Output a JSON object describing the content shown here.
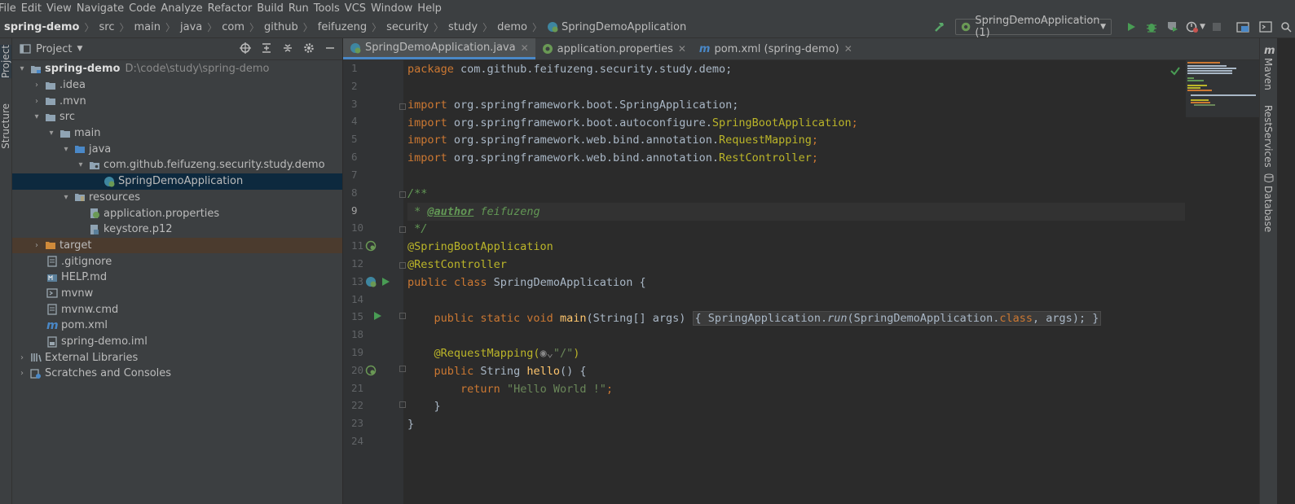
{
  "menu": [
    "File",
    "Edit",
    "View",
    "Navigate",
    "Code",
    "Analyze",
    "Refactor",
    "Build",
    "Run",
    "Tools",
    "VCS",
    "Window",
    "Help"
  ],
  "breadcrumb": {
    "project": "spring-demo",
    "items": [
      "src",
      "main",
      "java",
      "com",
      "github",
      "feifuzeng",
      "security",
      "study",
      "demo"
    ],
    "file": "SpringDemoApplication"
  },
  "run_config": "SpringDemoApplication (1)",
  "side_tabs": {
    "left": [
      "Project",
      "Structure"
    ],
    "right": [
      "Maven",
      "RestServices",
      "Database"
    ]
  },
  "project_panel": {
    "title": "Project",
    "tree": [
      {
        "label": "spring-demo",
        "path": "D:\\code\\study\\spring-demo"
      },
      {
        "label": ".idea"
      },
      {
        "label": ".mvn"
      },
      {
        "label": "src"
      },
      {
        "label": "main"
      },
      {
        "label": "java"
      },
      {
        "label": "com.github.feifuzeng.security.study.demo"
      },
      {
        "label": "SpringDemoApplication"
      },
      {
        "label": "resources"
      },
      {
        "label": "application.properties"
      },
      {
        "label": "keystore.p12"
      },
      {
        "label": "target"
      },
      {
        "label": ".gitignore"
      },
      {
        "label": "HELP.md"
      },
      {
        "label": "mvnw"
      },
      {
        "label": "mvnw.cmd"
      },
      {
        "label": "pom.xml"
      },
      {
        "label": "spring-demo.iml"
      },
      {
        "label": "External Libraries"
      },
      {
        "label": "Scratches and Consoles"
      }
    ]
  },
  "editor_tabs": [
    "SpringDemoApplication.java",
    "application.properties",
    "pom.xml (spring-demo)"
  ],
  "line_numbers": [
    "1",
    "2",
    "3",
    "4",
    "5",
    "6",
    "7",
    "8",
    "9",
    "10",
    "11",
    "12",
    "13",
    "14",
    "15",
    "18",
    "19",
    "20",
    "21",
    "22",
    "23",
    "24"
  ],
  "code": {
    "l1_kw": "package",
    "l1_rest": " com.github.feifuzeng.security.study.demo;",
    "imp_kw": "import",
    "l3": " org.springframework.boot.SpringApplication;",
    "l4_a": " org.springframework.boot.autoconfigure.",
    "l4_b": "SpringBootApplication",
    "l5_a": " org.springframework.web.bind.annotation.",
    "l5_b": "RequestMapping",
    "l6_a": " org.springframework.web.bind.annotation.",
    "l6_b": "RestController",
    "semi": ";",
    "l8": "/**",
    "l9_a": " * ",
    "l9_tag": "@author",
    "l9_b": " feifuzeng",
    "l10": " */",
    "l11": "@SpringBootApplication",
    "l12": "@RestController",
    "l13_kw": "public class",
    "l13_rest": " SpringDemoApplication {",
    "l15_kw": "public static void",
    "l15_fn": " main",
    "l15_args": "(String[] args) ",
    "l15_body_a": "{ SpringApplication.",
    "l15_run": "run",
    "l15_body_b": "(SpringDemoApplication.",
    "l15_class": "class",
    "l15_body_c": ", args); }",
    "l19_ann": "@RequestMapping(",
    "l19_str": "\"/\"",
    "l19_end": ")",
    "l20_kw": "public",
    "l20_type": " String ",
    "l20_fn": "hello",
    "l20_end": "() {",
    "l21_kw": "return",
    "l21_str": " \"Hello World !\"",
    "l22": "}",
    "l23": "}"
  }
}
